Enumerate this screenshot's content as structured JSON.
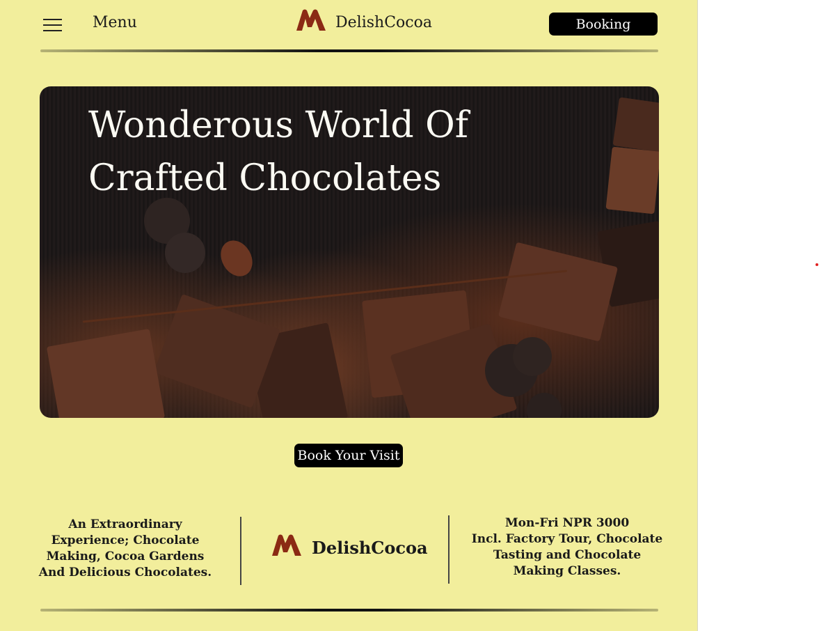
{
  "header": {
    "menu_label": "Menu",
    "brand_name": "DelishCocoa",
    "booking_label": "Booking"
  },
  "hero": {
    "title_line1": "Wonderous World Of",
    "title_line2": "Crafted Chocolates"
  },
  "cta": {
    "label": "Book Your Visit"
  },
  "info": {
    "left_text": "An Extraordinary Experience; Chocolate Making, Cocoa Gardens And Delicious Chocolates.",
    "brand_name": "DelishCocoa",
    "right_line1": "Mon-Fri NPR 3000",
    "right_line2": "Incl. Factory Tour, Chocolate Tasting and Chocolate Making Classes."
  },
  "colors": {
    "background": "#f2ee9c",
    "button": "#000000",
    "logo": "#8b2a14"
  },
  "icons": [
    "hamburger-menu-icon",
    "cocoa-logo-icon"
  ]
}
